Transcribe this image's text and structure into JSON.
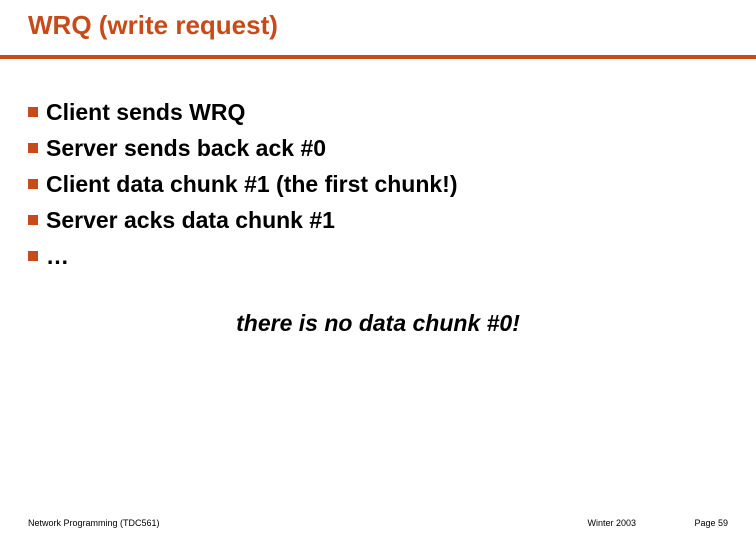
{
  "title": "WRQ (write request)",
  "bullets": [
    "Client sends WRQ",
    "Server sends back ack #0",
    "Client data chunk #1 (the first chunk!)",
    "Server acks data chunk #1",
    "…"
  ],
  "note": "there is no data chunk #0!",
  "footer": {
    "left": "Network Programming (TDC561)",
    "mid": "Winter 2003",
    "right": "Page 59"
  }
}
